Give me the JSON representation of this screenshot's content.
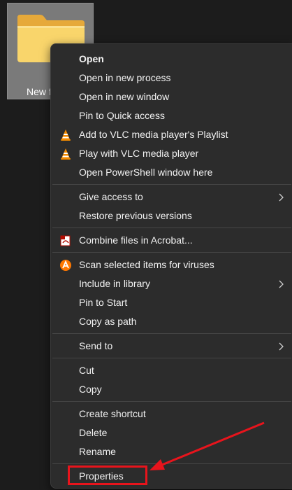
{
  "desktop": {
    "folder_label": "New f"
  },
  "menu": {
    "items": [
      {
        "label": "Open",
        "icon": "",
        "submenu": false,
        "bold": true
      },
      {
        "label": "Open in new process",
        "icon": "",
        "submenu": false
      },
      {
        "label": "Open in new window",
        "icon": "",
        "submenu": false
      },
      {
        "label": "Pin to Quick access",
        "icon": "",
        "submenu": false
      },
      {
        "label": "Add to VLC media player's Playlist",
        "icon": "vlc-cone-icon",
        "submenu": false
      },
      {
        "label": "Play with VLC media player",
        "icon": "vlc-cone-icon",
        "submenu": false
      },
      {
        "label": "Open PowerShell window here",
        "icon": "",
        "submenu": false
      },
      {
        "label": "Give access to",
        "icon": "",
        "submenu": true
      },
      {
        "label": "Restore previous versions",
        "icon": "",
        "submenu": false
      },
      {
        "label": "Combine files in Acrobat...",
        "icon": "acrobat-icon",
        "submenu": false
      },
      {
        "label": "Scan selected items for viruses",
        "icon": "avast-icon",
        "submenu": false
      },
      {
        "label": "Include in library",
        "icon": "",
        "submenu": true
      },
      {
        "label": "Pin to Start",
        "icon": "",
        "submenu": false
      },
      {
        "label": "Copy as path",
        "icon": "",
        "submenu": false
      },
      {
        "label": "Send to",
        "icon": "",
        "submenu": true
      },
      {
        "label": "Cut",
        "icon": "",
        "submenu": false
      },
      {
        "label": "Copy",
        "icon": "",
        "submenu": false
      },
      {
        "label": "Create shortcut",
        "icon": "",
        "submenu": false
      },
      {
        "label": "Delete",
        "icon": "",
        "submenu": false
      },
      {
        "label": "Rename",
        "icon": "",
        "submenu": false
      },
      {
        "label": "Properties",
        "icon": "",
        "submenu": false
      }
    ]
  },
  "colors": {
    "menu_background": "#2c2c2c",
    "menu_text": "#f2f2f2",
    "separator": "#454545",
    "annotation_red": "#e8141c",
    "vlc_orange": "#f48b00",
    "avast_orange": "#ff7800",
    "folder_yellow": "#f9d56b"
  }
}
